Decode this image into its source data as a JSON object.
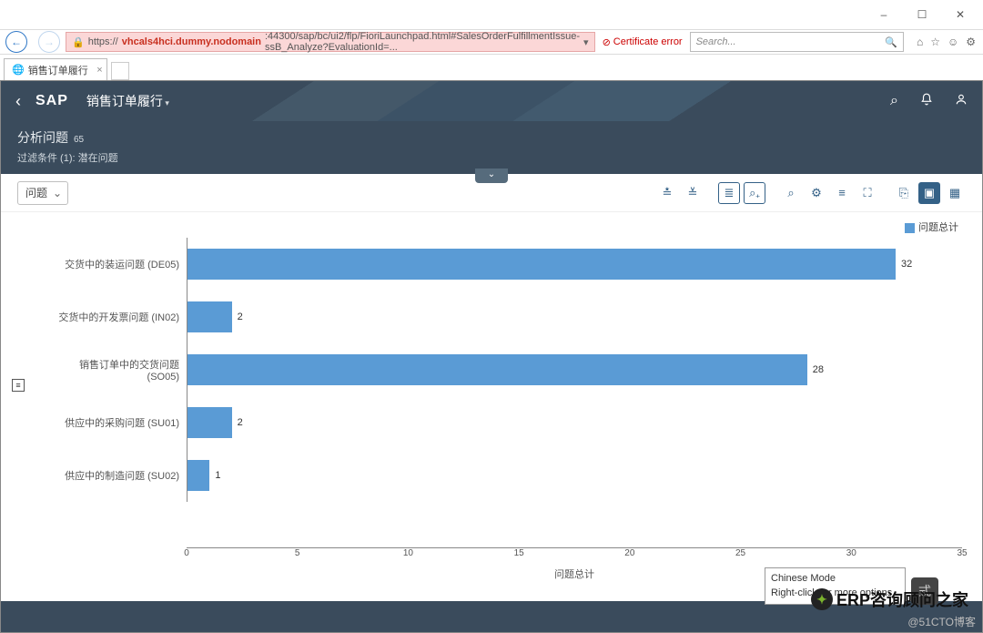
{
  "window": {
    "min": "–",
    "max": "☐",
    "close": "✕"
  },
  "browser": {
    "url": "https://vhcals4hci.dummy.nodomain:44300/sap/bc/ui2/flp/FioriLaunchpad.html#SalesOrderFulfillmentIssue-ssB_Analyze?EvaluationId=...",
    "url_prefix": "https://",
    "url_host_red": "vhcals4hci.dummy.nodomain",
    "url_rest": ":44300/sap/bc/ui2/flp/FioriLaunchpad.html#SalesOrderFulfillmentIssue-ssB_Analyze?EvaluationId=...",
    "cert_error": "Certificate error",
    "search_placeholder": "Search...",
    "tab_title": "销售订单履行",
    "refresh": "⟳",
    "home": "⌂",
    "star": "☆",
    "smile": "☺",
    "gear": "⚙"
  },
  "shell": {
    "logo": "SAP",
    "app_title": "销售订单履行",
    "search_ic": "⌕",
    "bell_ic": "🔔",
    "user_ic": "👤"
  },
  "page": {
    "title": "分析问题",
    "count": "65",
    "filter_line": "过滤条件 (1):   潜在问题",
    "expand": "⌄",
    "dd_label": "问题"
  },
  "toolbar": [
    {
      "name": "collapse-all-icon",
      "glyph": "≛"
    },
    {
      "name": "expand-all-icon",
      "glyph": "≚"
    },
    {
      "name": "list-icon",
      "glyph": "≣",
      "sel": true
    },
    {
      "name": "zoom-in-icon",
      "glyph": "⌕₊",
      "sel": true
    },
    {
      "name": "zoom-out-icon",
      "glyph": "⌕"
    },
    {
      "name": "settings-icon",
      "glyph": "⚙"
    },
    {
      "name": "legend-icon",
      "glyph": "≡"
    },
    {
      "name": "fullscreen-icon",
      "glyph": "⛶"
    },
    {
      "name": "copy-icon",
      "glyph": "⎘"
    },
    {
      "name": "chart-view-icon",
      "glyph": "▣",
      "dark": true
    },
    {
      "name": "table-view-icon",
      "glyph": "▦"
    }
  ],
  "chart_data": {
    "type": "bar",
    "orientation": "horizontal",
    "title": "",
    "xlabel": "问题总计",
    "ylabel": "",
    "xlim": [
      0,
      35
    ],
    "xticks": [
      0,
      5,
      10,
      15,
      20,
      25,
      30,
      35
    ],
    "legend": "问题总计",
    "series": [
      {
        "name": "问题总计",
        "color": "#5a9bd5"
      }
    ],
    "categories": [
      "交货中的装运问题 (DE05)",
      "交货中的开发票问题 (IN02)",
      "销售订单中的交货问题 (SO05)",
      "供应中的采购问题 (SU01)",
      "供应中的制造问题 (SU02)"
    ],
    "values": [
      32,
      2,
      28,
      2,
      1
    ]
  },
  "ime": {
    "line1": "Chinese Mode",
    "line2": "Right-click for more options",
    "btn": "式"
  },
  "wm": {
    "brand": "ERP咨询顾问之家",
    "site": "@51CTO博客"
  }
}
